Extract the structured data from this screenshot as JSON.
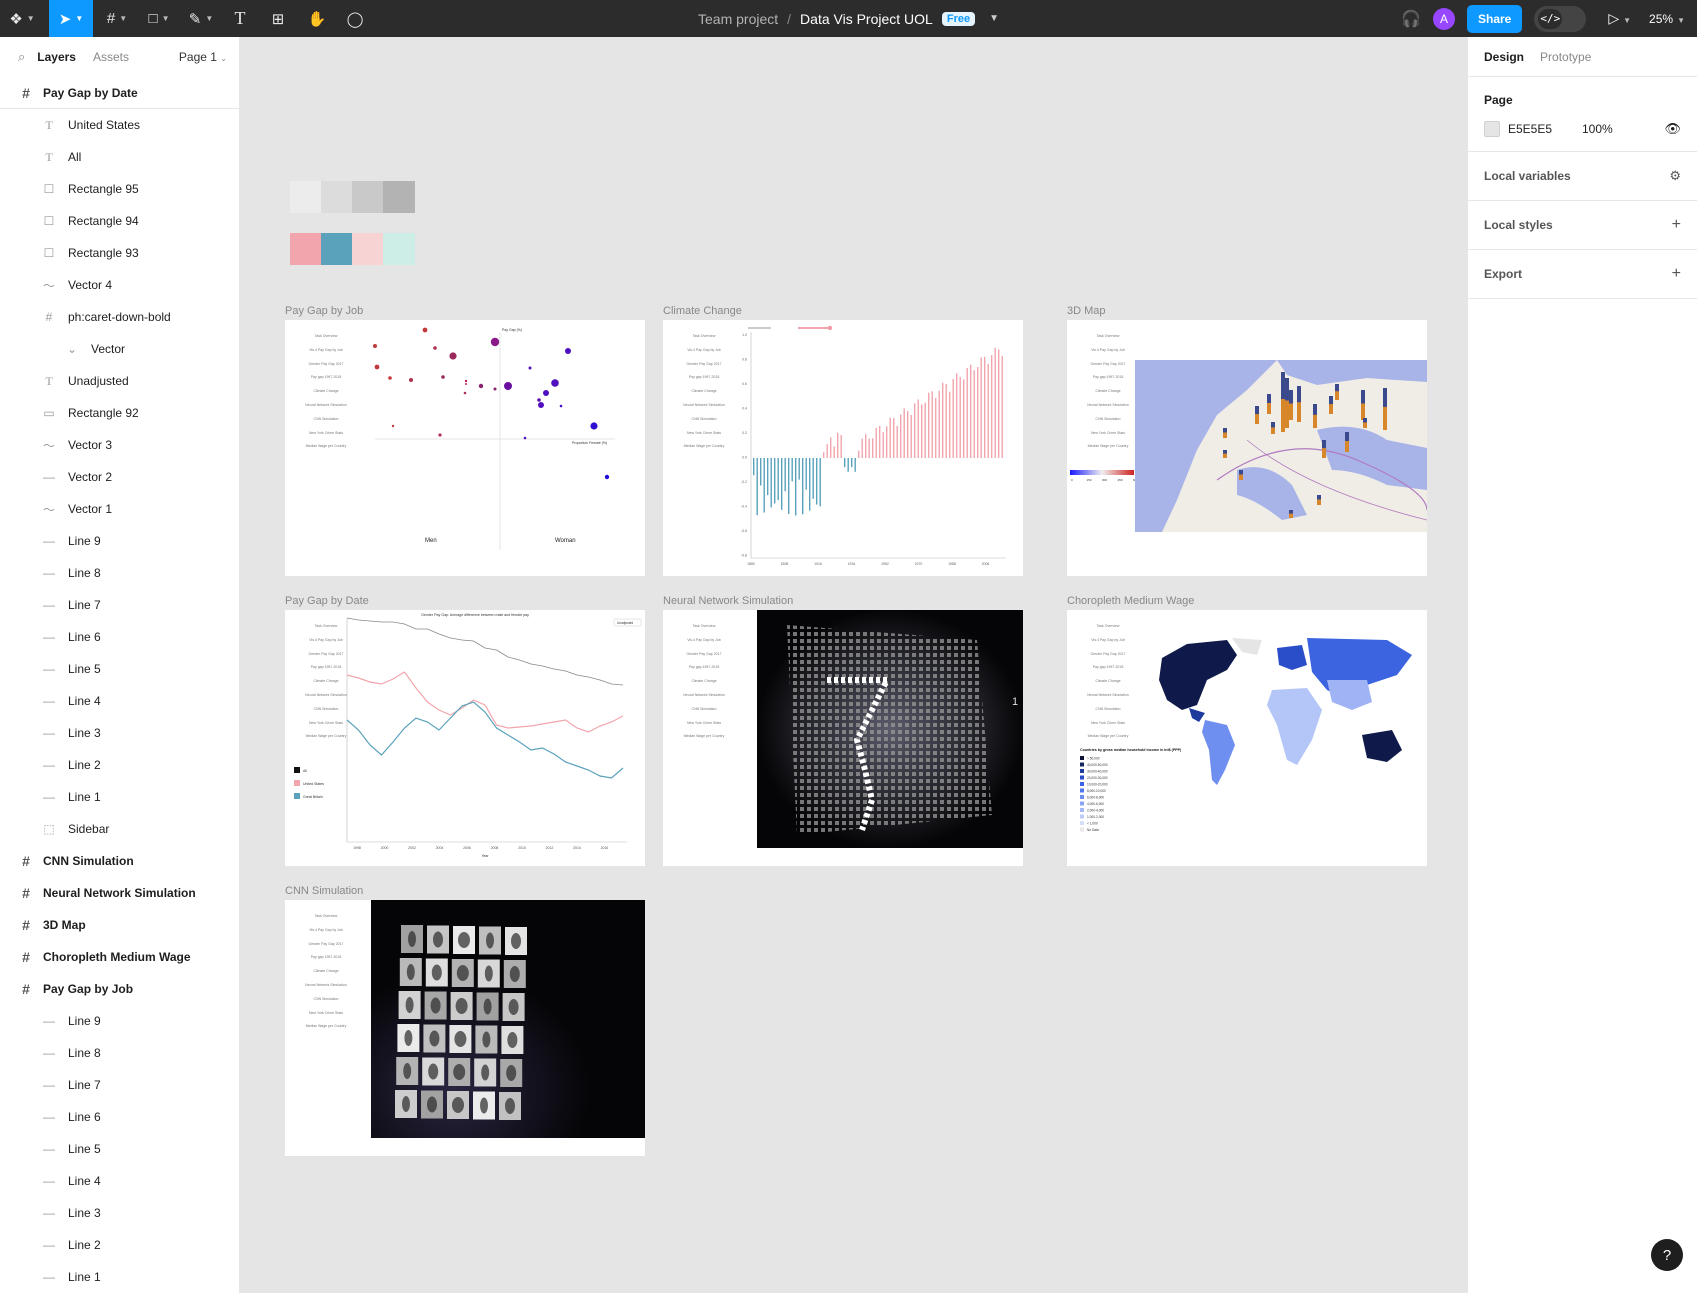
{
  "toolbar": {
    "project": "Team project",
    "separator": "/",
    "file_name": "Data Vis Project UOL",
    "plan_badge": "Free",
    "avatar_initial": "A",
    "share_label": "Share",
    "dev_mode_icon": "</>",
    "zoom": "25%"
  },
  "layers_panel": {
    "tab_layers": "Layers",
    "tab_assets": "Assets",
    "page_selector": "Page 1",
    "items": [
      {
        "label": "Pay Gap by Date",
        "icon": "frame-icon",
        "level": "frame"
      },
      {
        "label": "United States",
        "icon": "text-icon",
        "level": "child"
      },
      {
        "label": "All",
        "icon": "text-icon",
        "level": "child"
      },
      {
        "label": "Rectangle 95",
        "icon": "rectangle-icon",
        "level": "child"
      },
      {
        "label": "Rectangle 94",
        "icon": "rectangle-icon",
        "level": "child"
      },
      {
        "label": "Rectangle 93",
        "icon": "rectangle-icon",
        "level": "child"
      },
      {
        "label": "Vector 4",
        "icon": "vector-icon",
        "level": "child"
      },
      {
        "label": "ph:caret-down-bold",
        "icon": "frame-icon",
        "level": "child"
      },
      {
        "label": "Vector",
        "icon": "chevron-down-icon",
        "level": "grand"
      },
      {
        "label": "Unadjusted",
        "icon": "text-icon",
        "level": "child"
      },
      {
        "label": "Rectangle 92",
        "icon": "rounded-rectangle-icon",
        "level": "child"
      },
      {
        "label": "Vector 3",
        "icon": "vector-icon",
        "level": "child"
      },
      {
        "label": "Vector 2",
        "icon": "line-icon",
        "level": "child"
      },
      {
        "label": "Vector 1",
        "icon": "vector-icon",
        "level": "child"
      },
      {
        "label": "Line 9",
        "icon": "line-icon",
        "level": "child"
      },
      {
        "label": "Line 8",
        "icon": "line-icon",
        "level": "child"
      },
      {
        "label": "Line 7",
        "icon": "line-icon",
        "level": "child"
      },
      {
        "label": "Line 6",
        "icon": "line-icon",
        "level": "child"
      },
      {
        "label": "Line 5",
        "icon": "line-icon",
        "level": "child"
      },
      {
        "label": "Line 4",
        "icon": "line-icon",
        "level": "child"
      },
      {
        "label": "Line 3",
        "icon": "line-icon",
        "level": "child"
      },
      {
        "label": "Line 2",
        "icon": "line-icon",
        "level": "child"
      },
      {
        "label": "Line 1",
        "icon": "line-icon",
        "level": "child"
      },
      {
        "label": "Sidebar",
        "icon": "dashed-frame-icon",
        "level": "child"
      },
      {
        "label": "CNN Simulation",
        "icon": "frame-icon",
        "level": "frame"
      },
      {
        "label": "Neural Network Simulation",
        "icon": "frame-icon",
        "level": "frame"
      },
      {
        "label": "3D Map",
        "icon": "frame-icon",
        "level": "frame"
      },
      {
        "label": "Choropleth Medium Wage",
        "icon": "frame-icon",
        "level": "frame"
      },
      {
        "label": "Pay Gap by Job",
        "icon": "frame-icon",
        "level": "frame"
      },
      {
        "label": "Line 9",
        "icon": "line-icon",
        "level": "child"
      },
      {
        "label": "Line 8",
        "icon": "line-icon",
        "level": "child"
      },
      {
        "label": "Line 7",
        "icon": "line-icon",
        "level": "child"
      },
      {
        "label": "Line 6",
        "icon": "line-icon",
        "level": "child"
      },
      {
        "label": "Line 5",
        "icon": "line-icon",
        "level": "child"
      },
      {
        "label": "Line 4",
        "icon": "line-icon",
        "level": "child"
      },
      {
        "label": "Line 3",
        "icon": "line-icon",
        "level": "child"
      },
      {
        "label": "Line 2",
        "icon": "line-icon",
        "level": "child"
      },
      {
        "label": "Line 1",
        "icon": "line-icon",
        "level": "child"
      }
    ]
  },
  "design_panel": {
    "tab_design": "Design",
    "tab_prototype": "Prototype",
    "page_heading": "Page",
    "page_color": "E5E5E5",
    "page_opacity": "100%",
    "local_variables": "Local variables",
    "local_styles": "Local styles",
    "export": "Export"
  },
  "canvas": {
    "palette_grays": [
      "#ececec",
      "#dcdcdc",
      "#c9c9c9",
      "#b3b3b3"
    ],
    "palette_colors": [
      "#f2a5ac",
      "#5aa2bb",
      "#f8d3d3",
      "#cdeee6"
    ],
    "frames": {
      "pay_gap_by_job": "Pay Gap by Job",
      "climate_change": "Climate Change",
      "map_3d": "3D Map",
      "pay_gap_by_date": "Pay Gap by Date",
      "neural_network": "Neural Network Simulation",
      "choropleth": "Choropleth Medium Wage",
      "cnn": "CNN Simulation"
    },
    "mini_nav": [
      "Task Overview",
      "Vis.4 Pay Gap by Job",
      "Gender Pay Gap 2017",
      "Pay gap 1997-2018",
      "Climate Change",
      "Neural Network Simulation",
      "CNN Simulation",
      "New York Crime Stats",
      "Median Wage per Country"
    ],
    "scatter": {
      "title": "Pay Gap (%)",
      "x_axis": "Proportion Female (%)",
      "group_left": "Men",
      "group_right": "Woman"
    },
    "line_chart": {
      "title": "Gender Pay Gap: Average difference between male and female pay",
      "dropdown": "Unadjusted",
      "legend": [
        "All",
        "United States",
        "Great Britain"
      ],
      "xlabel": "Year",
      "x_ticks": [
        "1998",
        "2000",
        "2002",
        "2004",
        "2006",
        "2008",
        "2010",
        "2012",
        "2014",
        "2016"
      ]
    },
    "map3d_legend": [
      "0",
      "150",
      "300",
      "450",
      "600"
    ],
    "choropleth_legend": {
      "title": "Countries by gross median household income in Int$ (PPP)",
      "items": [
        "> 50,000",
        "40,000-50,000",
        "30,000-40,000",
        "20,000-30,000",
        "10,000-20,000",
        "8,000-10,000",
        "6,000-8,000",
        "4,000-6,000",
        "2,000-4,000",
        "1,000-2,000",
        "< 1,000",
        "No Data"
      ]
    },
    "climate_x_ticks": [
      "1880",
      "1898",
      "1916",
      "1934",
      "1952",
      "1970",
      "1988",
      "2006"
    ],
    "climate_y_ticks": [
      "1.0",
      "0.8",
      "0.6",
      "0.4",
      "0.2",
      "0.0",
      "-0.2",
      "-0.4",
      "-0.6",
      "-0.8"
    ]
  }
}
